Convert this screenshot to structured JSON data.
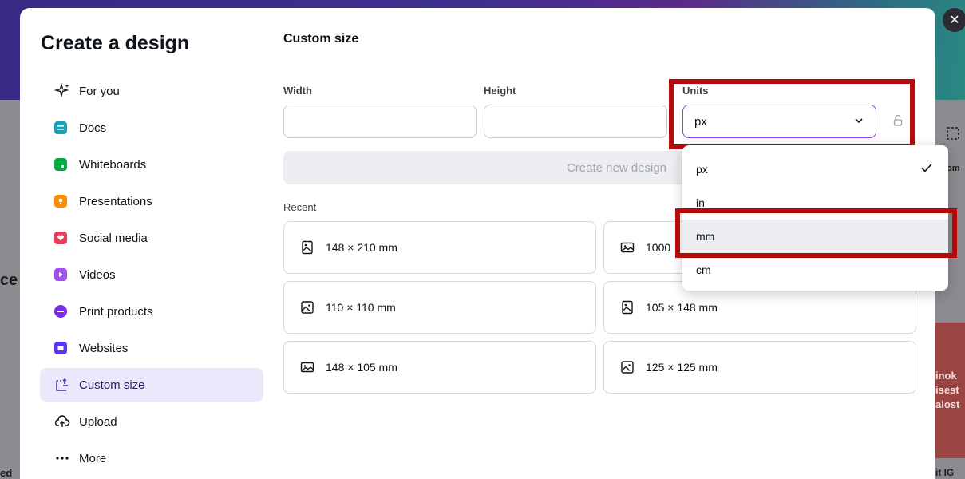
{
  "background": {
    "left_text_1": "ce",
    "left_text_2": "ed",
    "right_text_1": "om",
    "red_lines": [
      "inok",
      "isest",
      "alost"
    ],
    "bottom_right_text": "it IG"
  },
  "modal": {
    "title": "Create a design",
    "nav": [
      {
        "label": "For you",
        "icon": "sparkle-icon"
      },
      {
        "label": "Docs",
        "icon": "docs-icon",
        "color": "#13a3b5"
      },
      {
        "label": "Whiteboards",
        "icon": "whiteboard-icon",
        "color": "#0ba84a"
      },
      {
        "label": "Presentations",
        "icon": "presentation-icon",
        "color": "#ff8b00"
      },
      {
        "label": "Social media",
        "icon": "heart-icon",
        "color": "#ec3a54"
      },
      {
        "label": "Videos",
        "icon": "video-icon",
        "color": "#a24ff4"
      },
      {
        "label": "Print products",
        "icon": "print-icon",
        "color": "#7d2ae8"
      },
      {
        "label": "Websites",
        "icon": "website-icon",
        "color": "#5a32fa"
      },
      {
        "label": "Custom size",
        "icon": "custom-size-icon",
        "active": true
      },
      {
        "label": "Upload",
        "icon": "upload-icon"
      },
      {
        "label": "More",
        "icon": "more-icon"
      }
    ],
    "section_title": "Custom size",
    "width_label": "Width",
    "height_label": "Height",
    "units_label": "Units",
    "units_value": "px",
    "create_button": "Create new design",
    "recent_label": "Recent",
    "recent": [
      {
        "label": "148 × 210 mm",
        "icon": "portrait-image-icon"
      },
      {
        "label": "1000",
        "icon": "landscape-image-icon"
      },
      {
        "label": "110 × 110 mm",
        "icon": "square-image-icon"
      },
      {
        "label": "105 × 148 mm",
        "icon": "portrait-image-icon"
      },
      {
        "label": "148 × 105 mm",
        "icon": "landscape-image-icon"
      },
      {
        "label": "125 × 125 mm",
        "icon": "square-image-icon"
      }
    ]
  },
  "dropdown": {
    "options": [
      "px",
      "in",
      "mm",
      "cm"
    ],
    "selected": "px",
    "hovered": "mm"
  },
  "colors": {
    "accent": "#8b3dff",
    "highlight": "#b40a0a",
    "active_nav_bg": "#ece7fb"
  }
}
